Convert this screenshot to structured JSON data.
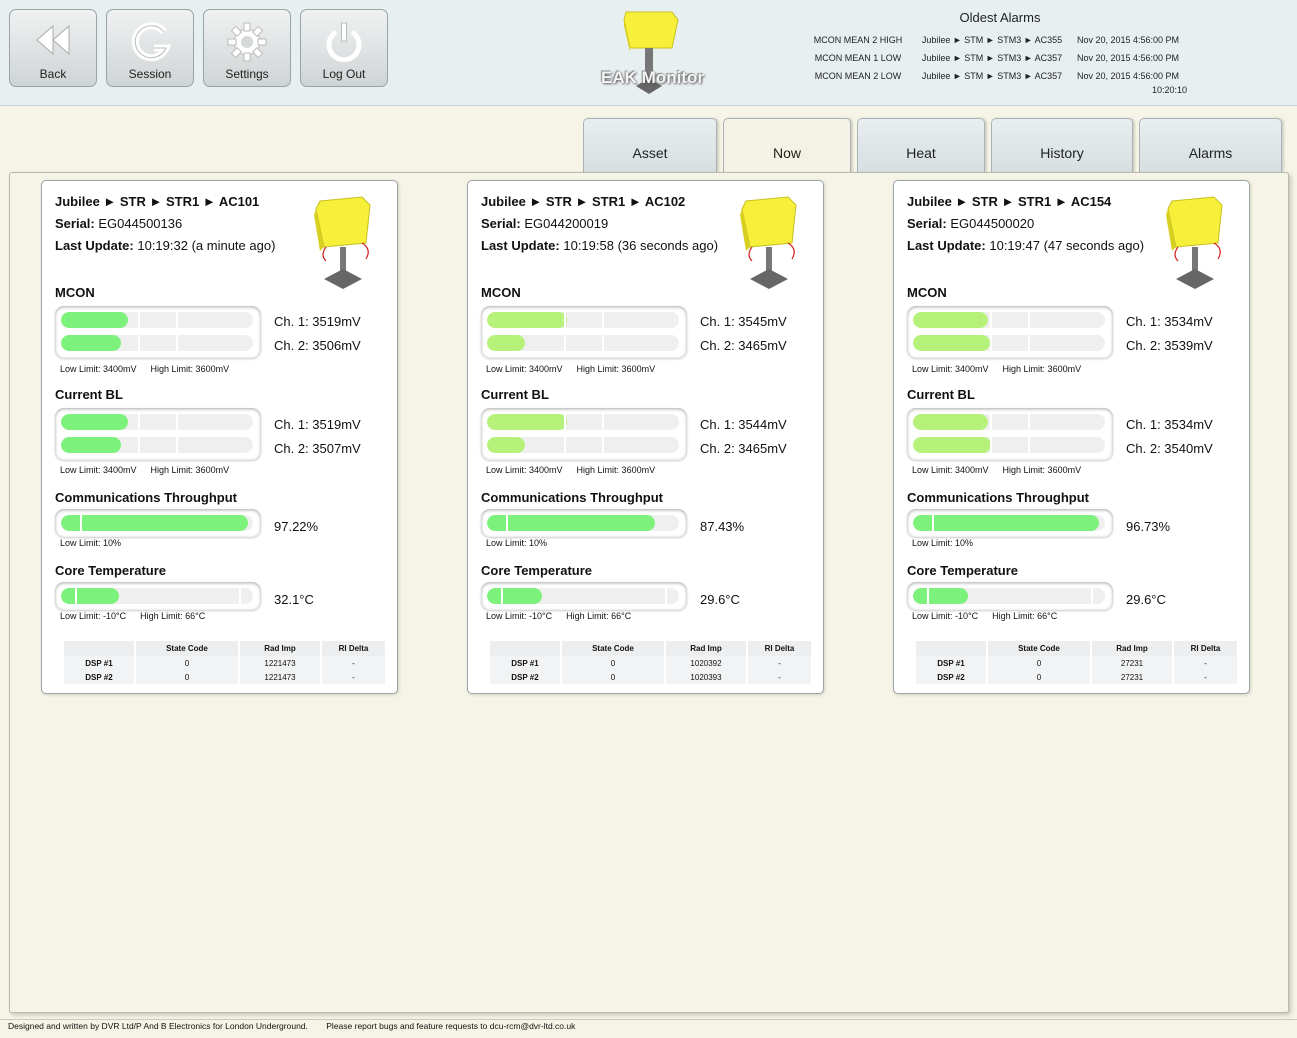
{
  "toolbar": {
    "buttons": [
      {
        "label": "Back",
        "icon": "rewind-icon"
      },
      {
        "label": "Session",
        "icon": "session-icon"
      },
      {
        "label": "Settings",
        "icon": "gear-icon"
      },
      {
        "label": "Log Out",
        "icon": "power-icon"
      }
    ]
  },
  "logo": {
    "text": "EAK Monitor",
    "icon": "device-icon"
  },
  "alarms": {
    "title": "Oldest Alarms",
    "rows": [
      {
        "name": "MCON MEAN 2 HIGH",
        "path": "Jubilee ► STM ► STM3 ► AC355",
        "time": "Nov 20, 2015 4:56:00 PM"
      },
      {
        "name": "MCON MEAN 1 LOW",
        "path": "Jubilee ► STM ► STM3 ► AC357",
        "time": "Nov 20, 2015 4:56:00 PM"
      },
      {
        "name": "MCON MEAN 2 LOW",
        "path": "Jubilee ► STM ► STM3 ► AC357",
        "time": "Nov 20, 2015 4:56:00 PM"
      }
    ],
    "clock": "10:20:10"
  },
  "tabs": [
    "Asset",
    "Now",
    "Heat",
    "History",
    "Alarms"
  ],
  "active_tab": "Now",
  "colors": {
    "bright_green": "#7cf27c",
    "light_green": "#b6f27a",
    "mid_green": "#9ff07a"
  },
  "labels": {
    "serial": "Serial:",
    "last_update": "Last Update:",
    "mcon": "MCON",
    "current_bl": "Current BL",
    "comms": "Communications Throughput",
    "core_temp": "Core Temperature",
    "low_limit_mv": "Low Limit: 3400mV",
    "high_limit_mv": "High Limit: 3600mV",
    "low_limit_pct": "Low Limit: 10%",
    "low_limit_temp": "Low Limit: -10°C",
    "high_limit_temp": "High Limit: 66°C",
    "dsp_headers": [
      "",
      "State Code",
      "Rad Imp",
      "RI Delta"
    ]
  },
  "cards": [
    {
      "path": "Jubilee ► STR ► STR1 ► AC101",
      "serial": "EG044500136",
      "last_update": "10:19:32 (a minute ago)",
      "mcon": {
        "ch1": "Ch. 1: 3519mV",
        "ch2": "Ch. 2: 3506mV",
        "ch1_mv": 3519,
        "ch2_mv": 3506
      },
      "current_bl": {
        "ch1": "Ch. 1: 3519mV",
        "ch2": "Ch. 2: 3507mV",
        "ch1_mv": 3519,
        "ch2_mv": 3507
      },
      "comms": {
        "text": "97.22%",
        "value": 97.22
      },
      "core_temp": {
        "text": "32.1°C",
        "value": 32.1
      },
      "dsp_rows": [
        {
          "name": "DSP #1",
          "state": "0",
          "rad": "1221473",
          "delta": "-"
        },
        {
          "name": "DSP #2",
          "state": "0",
          "rad": "1221473",
          "delta": "-"
        }
      ]
    },
    {
      "path": "Jubilee ► STR ► STR1 ► AC102",
      "serial": "EG044200019",
      "last_update": "10:19:58 (36 seconds ago)",
      "mcon": {
        "ch1": "Ch. 1: 3545mV",
        "ch2": "Ch. 2: 3465mV",
        "ch1_mv": 3545,
        "ch2_mv": 3465
      },
      "current_bl": {
        "ch1": "Ch. 1: 3544mV",
        "ch2": "Ch. 2: 3465mV",
        "ch1_mv": 3544,
        "ch2_mv": 3465
      },
      "comms": {
        "text": "87.43%",
        "value": 87.43
      },
      "core_temp": {
        "text": "29.6°C",
        "value": 29.6
      },
      "dsp_rows": [
        {
          "name": "DSP #1",
          "state": "0",
          "rad": "1020392",
          "delta": "-"
        },
        {
          "name": "DSP #2",
          "state": "0",
          "rad": "1020393",
          "delta": "-"
        }
      ]
    },
    {
      "path": "Jubilee ► STR ► STR1 ► AC154",
      "serial": "EG044500020",
      "last_update": "10:19:47 (47 seconds ago)",
      "mcon": {
        "ch1": "Ch. 1: 3534mV",
        "ch2": "Ch. 2: 3539mV",
        "ch1_mv": 3534,
        "ch2_mv": 3539
      },
      "current_bl": {
        "ch1": "Ch. 1: 3534mV",
        "ch2": "Ch. 2: 3540mV",
        "ch1_mv": 3534,
        "ch2_mv": 3540
      },
      "comms": {
        "text": "96.73%",
        "value": 96.73
      },
      "core_temp": {
        "text": "29.6°C",
        "value": 29.6
      },
      "dsp_rows": [
        {
          "name": "DSP #1",
          "state": "0",
          "rad": "27231",
          "delta": "-"
        },
        {
          "name": "DSP #2",
          "state": "0",
          "rad": "27231",
          "delta": "-"
        }
      ]
    }
  ],
  "footer": {
    "credit": "Designed and written by DVR Ltd/P And B Electronics for London Underground.",
    "report": "Please report bugs and feature requests to dcu-rcm@dvr-ltd.co.uk"
  }
}
